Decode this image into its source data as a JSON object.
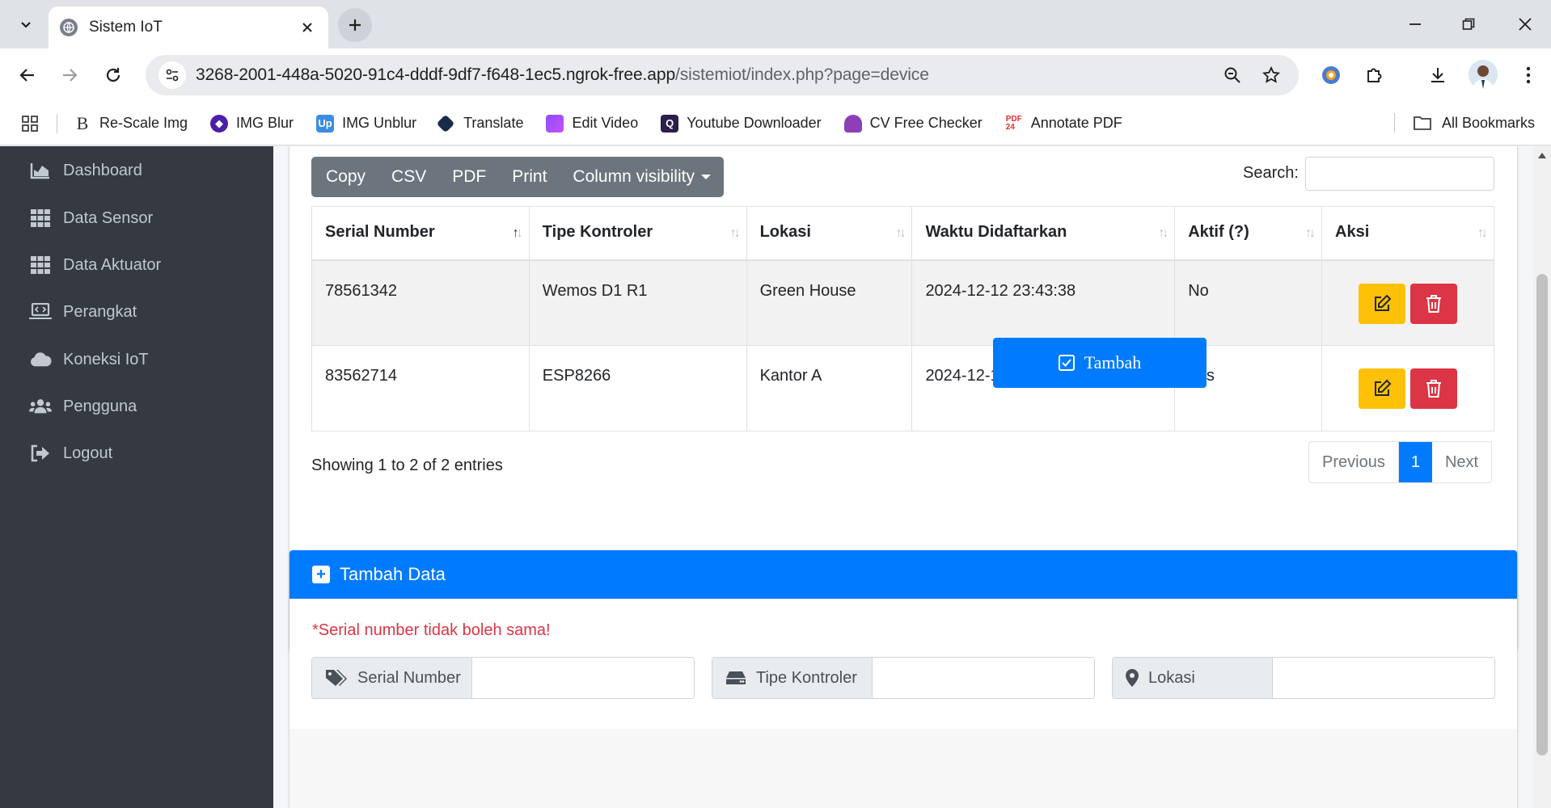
{
  "browser": {
    "tab_title": "Sistem IoT",
    "url_host": "3268-2001-448a-5020-91c4-dddf-9df7-f648-1ec5.ngrok-free.app",
    "url_path": "/sistemiot/index.php?page=device",
    "bookmarks": [
      {
        "label": "Re-Scale Img",
        "icon": "rescale-icon"
      },
      {
        "label": "IMG Blur",
        "icon": "img-blur-icon"
      },
      {
        "label": "IMG Unblur",
        "icon": "img-unblur-icon"
      },
      {
        "label": "Translate",
        "icon": "translate-icon"
      },
      {
        "label": "Edit Video",
        "icon": "edit-video-icon"
      },
      {
        "label": "Youtube Downloader",
        "icon": "youtube-downloader-icon"
      },
      {
        "label": "CV Free Checker",
        "icon": "cv-checker-icon"
      },
      {
        "label": "Annotate PDF",
        "icon": "annotate-pdf-icon"
      }
    ],
    "all_bookmarks": "All Bookmarks"
  },
  "sidebar": {
    "items": [
      {
        "label": "Dashboard",
        "icon": "chart-area-icon"
      },
      {
        "label": "Data Sensor",
        "icon": "grid-icon"
      },
      {
        "label": "Data Aktuator",
        "icon": "grid-icon"
      },
      {
        "label": "Perangkat",
        "icon": "laptop-code-icon"
      },
      {
        "label": "Koneksi IoT",
        "icon": "cloud-icon"
      },
      {
        "label": "Pengguna",
        "icon": "users-icon"
      },
      {
        "label": "Logout",
        "icon": "sign-out-icon"
      }
    ]
  },
  "table_tools": {
    "buttons": [
      "Copy",
      "CSV",
      "PDF",
      "Print",
      "Column visibility"
    ],
    "search_label": "Search:"
  },
  "table": {
    "columns": [
      "Serial Number",
      "Tipe Kontroler",
      "Lokasi",
      "Waktu Didaftarkan",
      "Aktif (?)",
      "Aksi"
    ],
    "rows": [
      {
        "serial": "78561342",
        "tipe": "Wemos D1 R1",
        "lokasi": "Green House",
        "waktu": "2024-12-12 23:43:38",
        "aktif": "No"
      },
      {
        "serial": "83562714",
        "tipe": "ESP8266",
        "lokasi": "Kantor A",
        "waktu": "2024-12-12 23:45:04",
        "aktif": "Yes"
      }
    ],
    "info": "Showing 1 to 2 of 2 entries",
    "pagination": {
      "previous": "Previous",
      "current": "1",
      "next": "Next"
    }
  },
  "form": {
    "title": "Tambah Data",
    "warning": "*Serial number tidak boleh sama!",
    "fields": [
      {
        "label": "Serial Number",
        "icon": "tags-icon",
        "value": ""
      },
      {
        "label": "Tipe Kontroler",
        "icon": "hdd-icon",
        "value": ""
      },
      {
        "label": "Lokasi",
        "icon": "map-marker-icon",
        "value": ""
      }
    ],
    "submit": "Tambah"
  },
  "colors": {
    "primary": "#007bff",
    "warning": "#ffc107",
    "danger": "#dc3545",
    "secondary": "#6c757d",
    "sidebar": "#343a40"
  }
}
